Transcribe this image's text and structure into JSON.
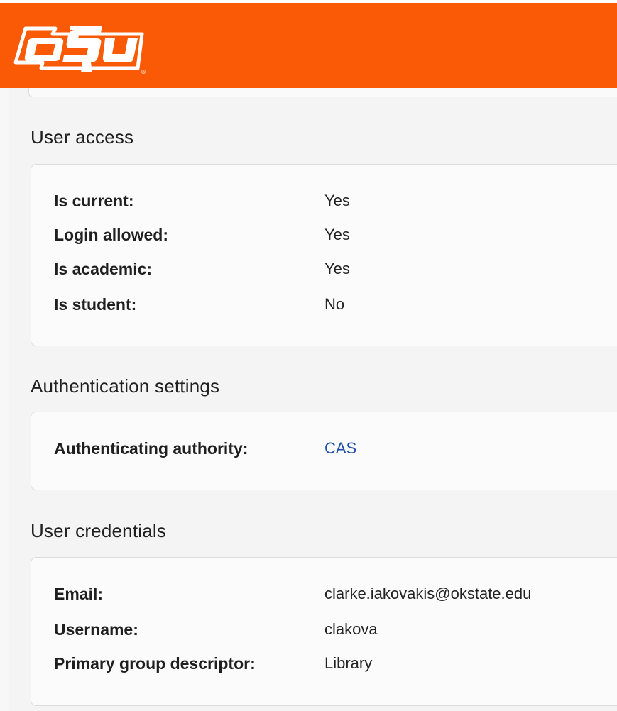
{
  "header": {
    "logo_text": "OSU",
    "background_color": "#fa5a06"
  },
  "sections": {
    "user_access": {
      "title": "User access",
      "rows": [
        {
          "label": "Is current:",
          "value": "Yes"
        },
        {
          "label": "Login allowed:",
          "value": "Yes"
        },
        {
          "label": "Is academic:",
          "value": "Yes"
        },
        {
          "label": "Is student:",
          "value": "No"
        }
      ]
    },
    "authentication_settings": {
      "title": "Authentication settings",
      "rows": [
        {
          "label": "Authenticating authority:",
          "value": "CAS"
        }
      ]
    },
    "user_credentials": {
      "title": "User credentials",
      "rows": [
        {
          "label": "Email:",
          "value": "clarke.iakovakis@okstate.edu"
        },
        {
          "label": "Username:",
          "value": "clakova"
        },
        {
          "label": "Primary group descriptor:",
          "value": "Library"
        }
      ]
    }
  },
  "colors": {
    "link": "#1f4fa8",
    "page_background": "#f4f4f4"
  }
}
